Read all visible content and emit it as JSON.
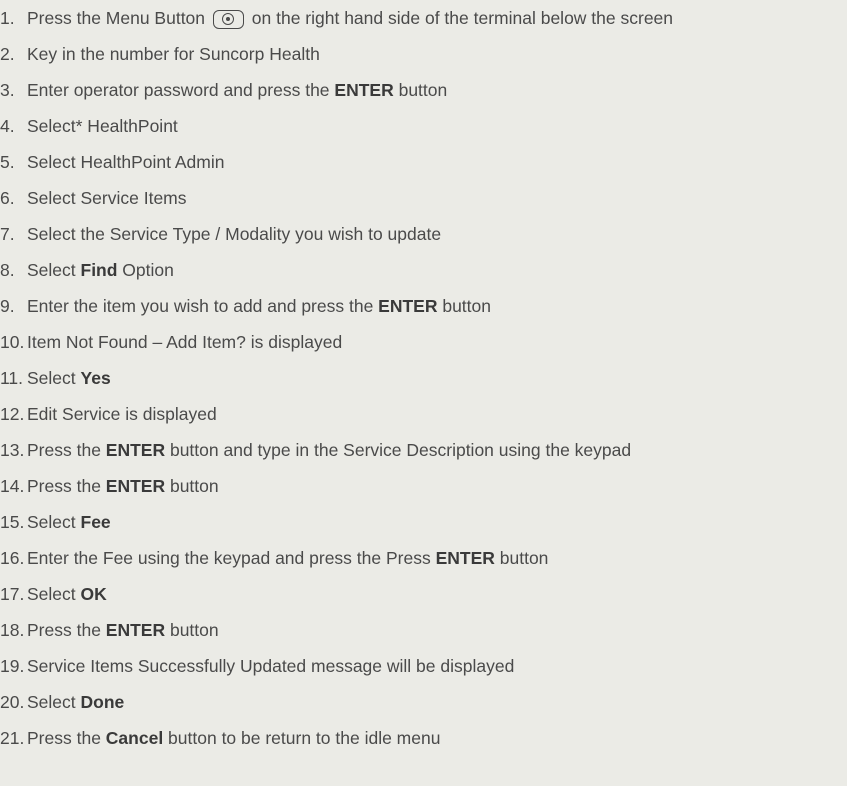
{
  "steps": [
    {
      "num": "1.",
      "pre": "Press the Menu Button",
      "post": "on the right hand side of the terminal below the screen"
    },
    {
      "num": "2.",
      "text": "Key in the number for Suncorp Health"
    },
    {
      "num": "3.",
      "pre": "Enter operator password and press the ",
      "bold": "ENTER",
      "post": " button"
    },
    {
      "num": "4.",
      "text": "Select* HealthPoint"
    },
    {
      "num": "5.",
      "text": "Select HealthPoint Admin"
    },
    {
      "num": "6.",
      "text": "Select Service Items"
    },
    {
      "num": "7.",
      "text": "Select the Service Type / Modality you wish to update"
    },
    {
      "num": "8.",
      "pre": "Select ",
      "bold": "Find",
      "post": " Option"
    },
    {
      "num": "9.",
      "pre": "Enter the item you wish to add and press the ",
      "bold": "ENTER",
      "post": " button"
    },
    {
      "num": "10.",
      "text": "Item Not Found – Add Item? is displayed"
    },
    {
      "num": "11.",
      "pre": "Select ",
      "bold": "Yes"
    },
    {
      "num": "12.",
      "text": "Edit Service is displayed"
    },
    {
      "num": "13.",
      "pre": "Press the ",
      "bold": "ENTER",
      "post": " button and type in the Service Description using the keypad"
    },
    {
      "num": "14.",
      "pre": "Press the ",
      "bold": "ENTER",
      "post": " button"
    },
    {
      "num": "15.",
      "pre": "Select ",
      "bold": "Fee"
    },
    {
      "num": "16.",
      "pre": "Enter the Fee using the keypad and press the Press ",
      "bold": "ENTER",
      "post": " button"
    },
    {
      "num": "17.",
      "pre": "Select ",
      "bold": "OK"
    },
    {
      "num": "18.",
      "pre": "Press the ",
      "bold": "ENTER",
      "post": " button"
    },
    {
      "num": "19.",
      "text": "Service Items Successfully Updated message will be displayed"
    },
    {
      "num": "20.",
      "pre": "Select ",
      "bold": "Done"
    },
    {
      "num": "21.",
      "pre": "Press the ",
      "bold": "Cancel",
      "post": " button to be return to the idle menu"
    }
  ],
  "icons": {
    "menu_button": "menu-button-icon"
  }
}
